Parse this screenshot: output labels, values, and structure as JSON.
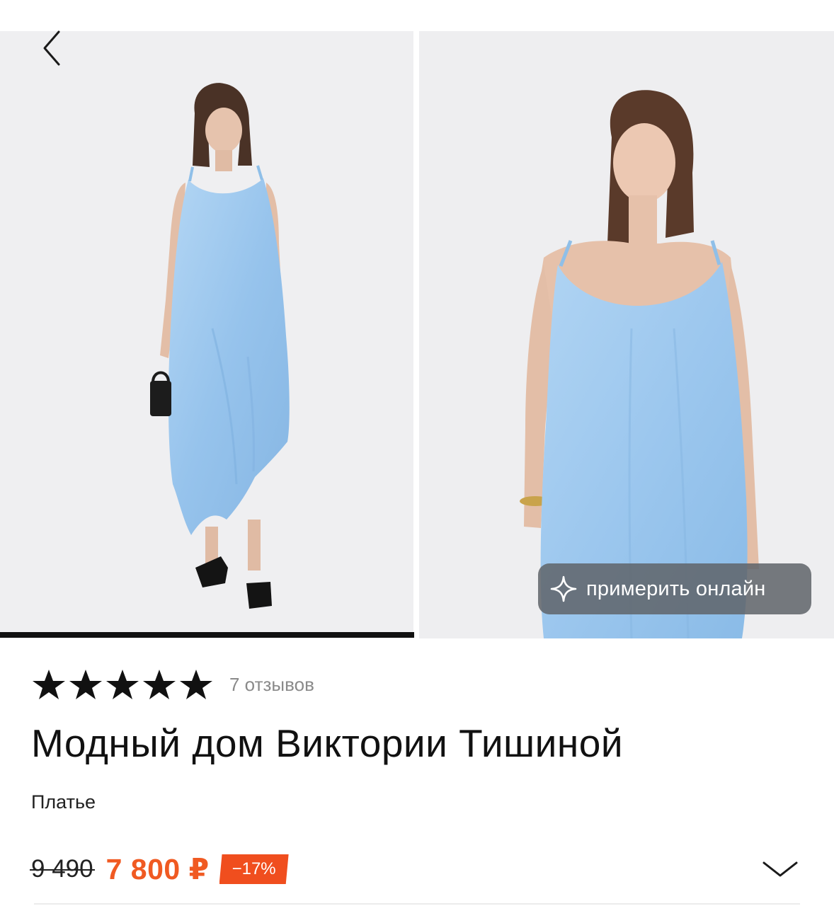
{
  "gallery": {
    "photo_1_alt": "",
    "photo_2_alt": "",
    "active_index": 1,
    "total": 2
  },
  "try_on": {
    "label": "примерить онлайн",
    "icon": "sparkle-icon"
  },
  "rating": {
    "value": 5,
    "max": 5,
    "reviews_label": "7 отзывов"
  },
  "product": {
    "brand": "Модный дом Виктории Тишиной",
    "type": "Платье"
  },
  "price": {
    "old": "9 490",
    "current": "7 800 ₽",
    "discount": "−17%"
  },
  "colors": {
    "accent": "#f05a22",
    "discount_bg": "#f04e1e",
    "dress": "#9ec9ef"
  }
}
